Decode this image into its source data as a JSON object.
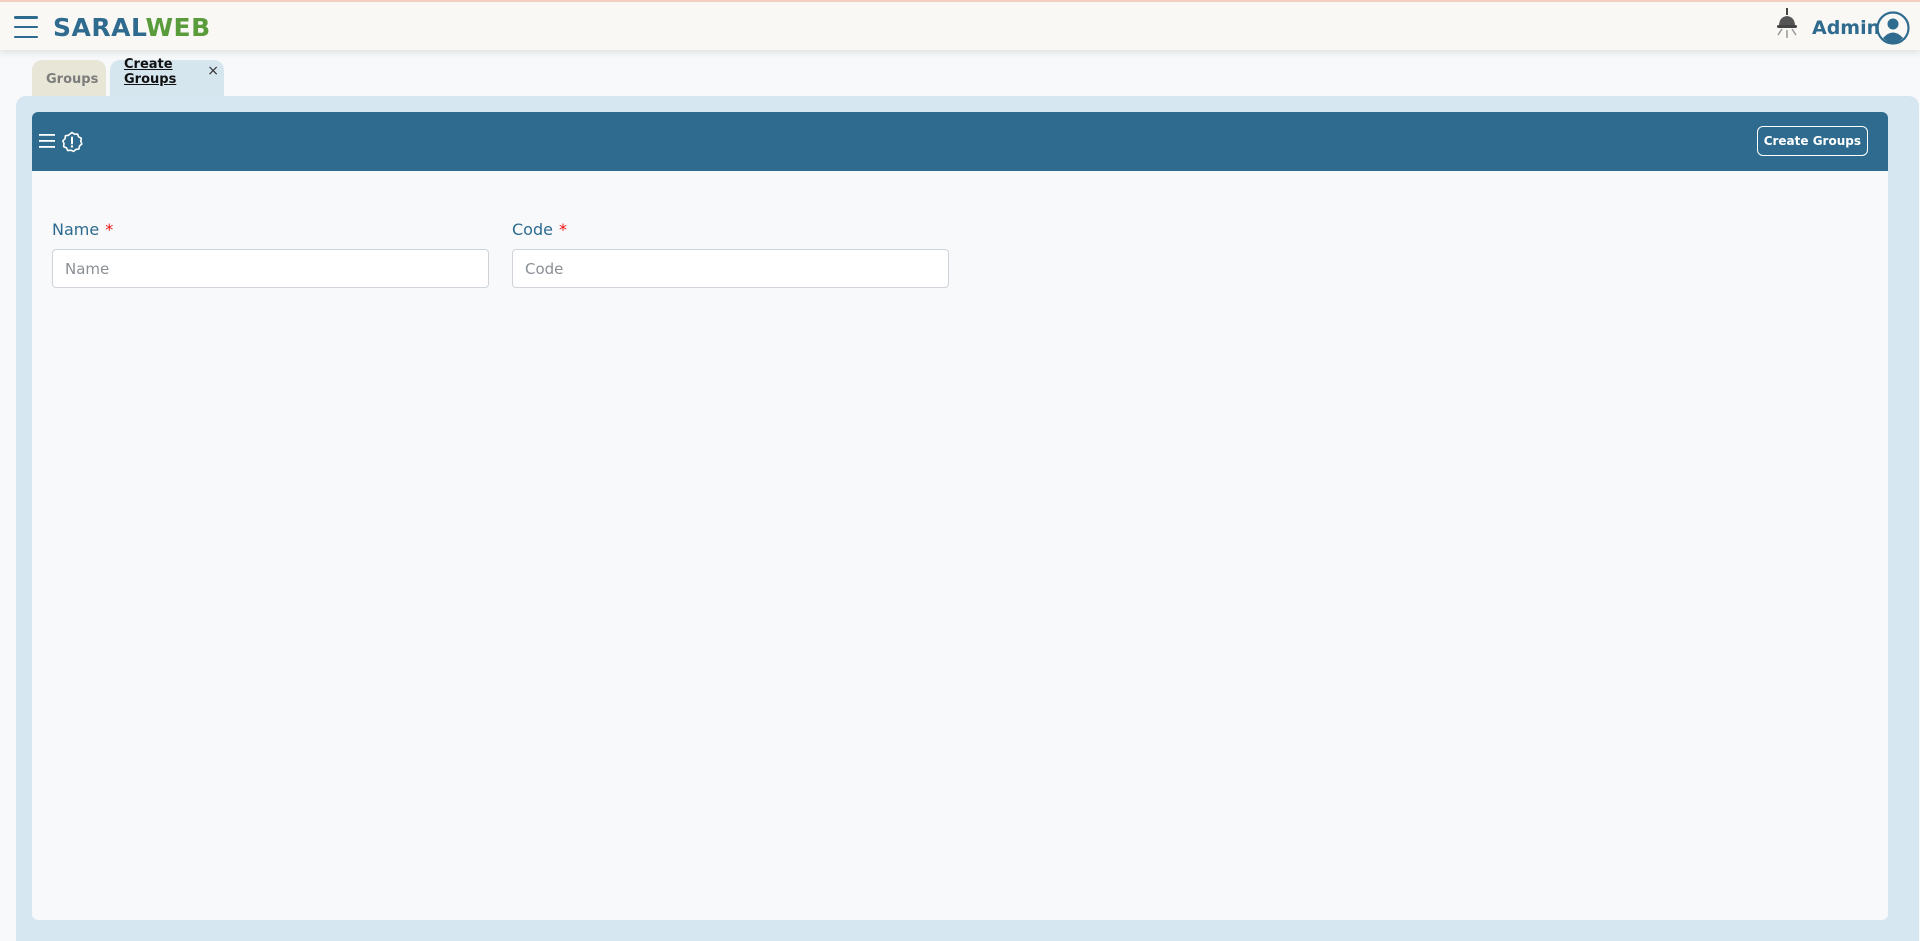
{
  "app": {
    "logo_part1": "SARAL",
    "logo_part2": "WEB",
    "user_name": "Admin"
  },
  "tabs": [
    {
      "label": "Groups",
      "active": false
    },
    {
      "label": "Create Groups",
      "active": true,
      "close": "×"
    }
  ],
  "toolbar": {
    "create_button_label": "Create Groups"
  },
  "form": {
    "name": {
      "label": "Name",
      "required_mark": "*",
      "placeholder": "Name",
      "value": ""
    },
    "code": {
      "label": "Code",
      "required_mark": "*",
      "placeholder": "Code",
      "value": ""
    }
  },
  "colors": {
    "primary": "#2e6b8e",
    "logo_green": "#5a9c3c",
    "required": "#e11111",
    "panel": "#d7e7f1"
  },
  "icons": {
    "menu": "hamburger-icon",
    "lamp": "lamp-icon",
    "user": "user-circle-icon",
    "list": "list-icon",
    "info": "info-badge-icon"
  }
}
